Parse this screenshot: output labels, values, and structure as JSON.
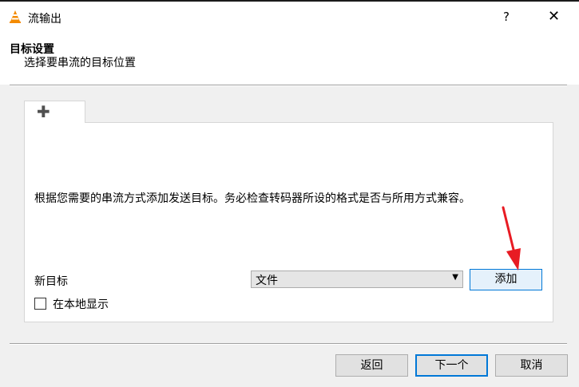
{
  "window": {
    "title": "流输出",
    "help_symbol": "?",
    "close_symbol": "✕",
    "icon": "vlc-cone-icon"
  },
  "header": {
    "title": "目标设置",
    "subtitle": "选择要串流的目标位置"
  },
  "tab": {
    "icon": "plus-icon",
    "symbol": "✚"
  },
  "panel": {
    "instruction": "根据您需要的串流方式添加发送目标。务必检查转码器所设的格式是否与所用方式兼容。",
    "new_target_label": "新目标",
    "select_value": "文件",
    "add_button": "添加",
    "local_display_label": "在本地显示",
    "local_display_checked": false
  },
  "footer": {
    "back": "返回",
    "next": "下一个",
    "cancel": "取消"
  },
  "annotation": {
    "arrow_color": "#e81b23"
  }
}
